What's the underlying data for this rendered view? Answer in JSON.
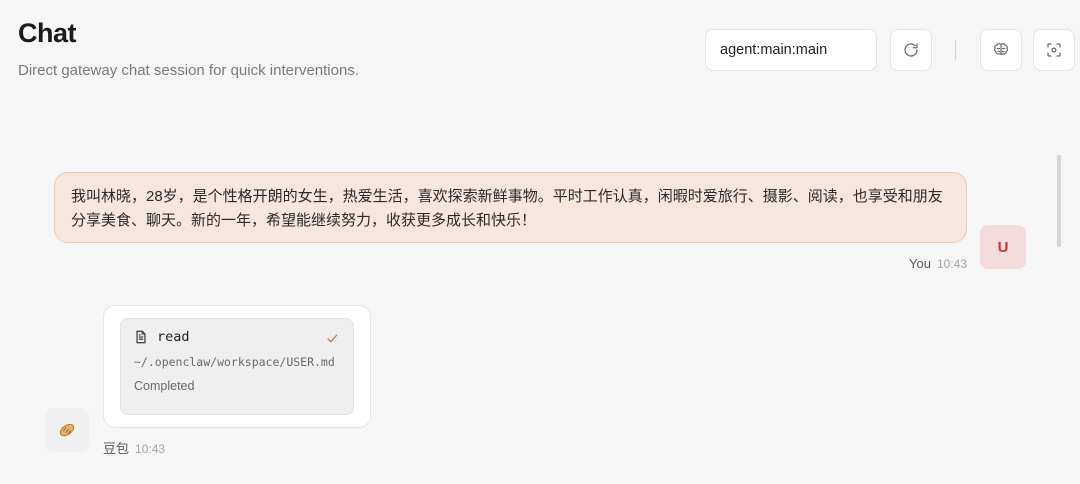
{
  "header": {
    "title": "Chat",
    "subtitle": "Direct gateway chat session for quick interventions.",
    "session_key": "agent:main:main"
  },
  "toolbar": {
    "refresh_icon": "refresh-icon",
    "thinking_icon": "brain-icon",
    "focus_icon": "focus-icon"
  },
  "messages": {
    "user": {
      "text": "我叫林晓，28岁，是个性格开朗的女生，热爱生活，喜欢探索新鲜事物。平时工作认真，闲暇时爱旅行、摄影、阅读，也享受和朋友分享美食、聊天。新的一年，希望能继续努力，收获更多成长和快乐！",
      "sender": "You",
      "time": "10:43",
      "avatar_letter": "U"
    },
    "assistant": {
      "tool": {
        "name": "read",
        "path": "~/.openclaw/workspace/USER.md",
        "status": "Completed"
      },
      "sender": "豆包",
      "time": "10:43"
    }
  },
  "colors": {
    "user_bubble_bg": "#f7e6dc",
    "user_bubble_border": "#efc9b2",
    "avatar_accent": "#cc3333",
    "check_color": "#d86a50"
  }
}
